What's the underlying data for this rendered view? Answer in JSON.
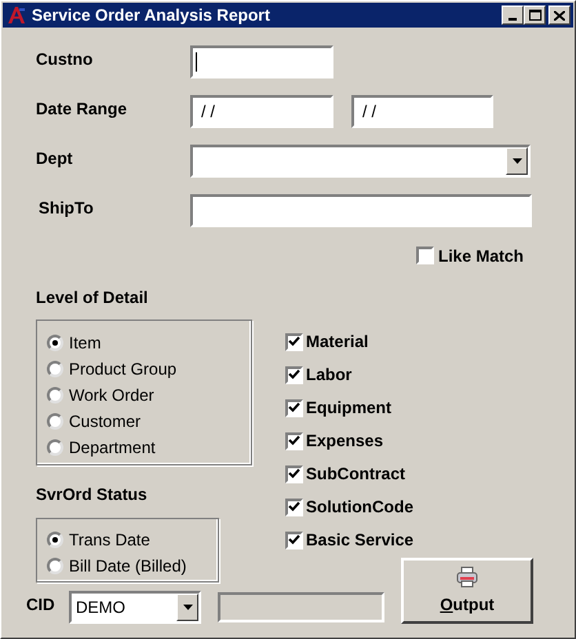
{
  "window": {
    "title": "Service Order Analysis Report"
  },
  "custno": {
    "label": "Custno",
    "focused": true
  },
  "date_range": {
    "label": "Date Range",
    "from": "/ /",
    "to": "/ /"
  },
  "dept": {
    "label": "Dept"
  },
  "ship_to": {
    "label": "ShipTo"
  },
  "like_match": {
    "label": "Like Match",
    "checked": false
  },
  "level_of_detail": {
    "label": "Level of Detail",
    "options": [
      {
        "label": "Item",
        "selected": true
      },
      {
        "label": "Product Group",
        "selected": false
      },
      {
        "label": "Work Order",
        "selected": false
      },
      {
        "label": "Customer",
        "selected": false
      },
      {
        "label": "Department",
        "selected": false
      }
    ]
  },
  "cost_types": [
    {
      "label": "Material",
      "checked": true
    },
    {
      "label": "Labor",
      "checked": true
    },
    {
      "label": "Equipment",
      "checked": true
    },
    {
      "label": "Expenses",
      "checked": true
    },
    {
      "label": "SubContract",
      "checked": true
    },
    {
      "label": "SolutionCode",
      "checked": true
    },
    {
      "label": "Basic Service",
      "checked": true
    }
  ],
  "svrord_status": {
    "label": "SvrOrd Status",
    "options": [
      {
        "label": "Trans Date",
        "selected": true
      },
      {
        "label": "Bill Date (Billed)",
        "selected": false
      }
    ]
  },
  "cid": {
    "label": "CID",
    "value": "DEMO"
  },
  "output_button": {
    "label": "Output"
  }
}
